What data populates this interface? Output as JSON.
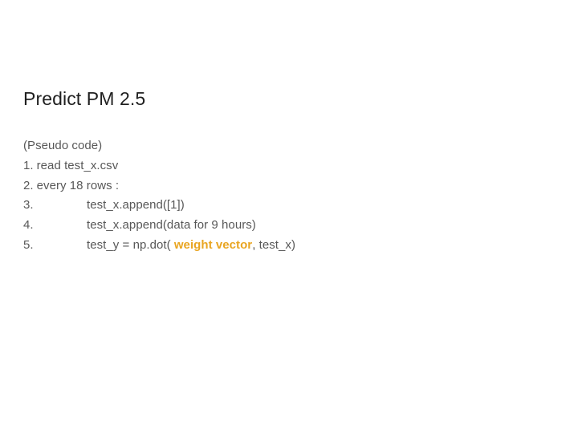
{
  "slide": {
    "title": "Predict PM 2.5",
    "background_color": "#ffffff",
    "title_color": "#1f1f1f",
    "body_color": "#585858",
    "highlight_color": "#e9a521"
  },
  "pseudo_code": {
    "header": "(Pseudo code)",
    "lines": [
      {
        "number": "1.",
        "indent": false,
        "text": "read test_x.csv",
        "pre_highlight": "read test_x.csv",
        "highlight": "",
        "post_highlight": ""
      },
      {
        "number": "2.",
        "indent": false,
        "text": "every 18 rows :",
        "pre_highlight": "every 18 rows :",
        "highlight": "",
        "post_highlight": ""
      },
      {
        "number": "3.",
        "indent": true,
        "text": "test_x.append([1])",
        "pre_highlight": "test_x.append([1])",
        "highlight": "",
        "post_highlight": ""
      },
      {
        "number": "4.",
        "indent": true,
        "text": "test_x.append(data for 9 hours)",
        "pre_highlight": "test_x.append(data for 9 hours)",
        "highlight": "",
        "post_highlight": ""
      },
      {
        "number": "5.",
        "indent": true,
        "text": "test_y = np.dot( weight vector, test_x)",
        "pre_highlight": "test_y = np.dot( ",
        "highlight": "weight vector",
        "post_highlight": ", test_x)"
      }
    ]
  }
}
